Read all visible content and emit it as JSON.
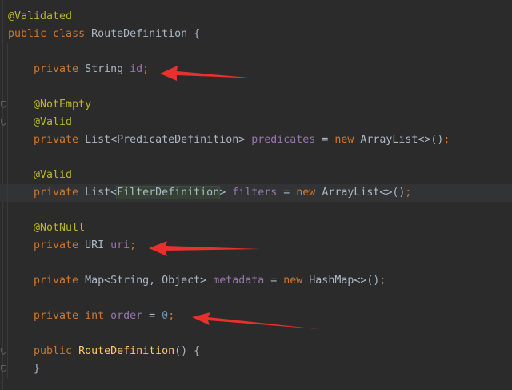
{
  "editor": {
    "lines": [
      {
        "id": "l01",
        "tokens": [
          {
            "t": "@Validated",
            "c": "ann"
          }
        ]
      },
      {
        "id": "l02",
        "tokens": [
          {
            "t": "public ",
            "c": "kw"
          },
          {
            "t": "class ",
            "c": "kw"
          },
          {
            "t": "RouteDefinition {",
            "c": "plain"
          }
        ]
      },
      {
        "id": "l03",
        "tokens": []
      },
      {
        "id": "l04",
        "tokens": [
          {
            "t": "    private ",
            "c": "kw"
          },
          {
            "t": "String ",
            "c": "plain"
          },
          {
            "t": "id",
            "c": "field"
          },
          {
            "t": ";",
            "c": "kw"
          }
        ]
      },
      {
        "id": "l05",
        "tokens": []
      },
      {
        "id": "l06",
        "tokens": [
          {
            "t": "    @NotEmpty",
            "c": "ann"
          }
        ]
      },
      {
        "id": "l07",
        "tokens": [
          {
            "t": "    @Valid",
            "c": "ann"
          }
        ]
      },
      {
        "id": "l08",
        "tokens": [
          {
            "t": "    private ",
            "c": "kw"
          },
          {
            "t": "List<PredicateDefinition> ",
            "c": "plain"
          },
          {
            "t": "predicates",
            "c": "field"
          },
          {
            "t": " = ",
            "c": "plain"
          },
          {
            "t": "new ",
            "c": "kw"
          },
          {
            "t": "ArrayList<>()",
            "c": "plain"
          },
          {
            "t": ";",
            "c": "kw"
          }
        ]
      },
      {
        "id": "l09",
        "tokens": []
      },
      {
        "id": "l10",
        "tokens": [
          {
            "t": "    @Valid",
            "c": "ann"
          }
        ]
      },
      {
        "id": "l11",
        "tokens": [
          {
            "t": "    private ",
            "c": "kw"
          },
          {
            "t": "List<",
            "c": "plain"
          },
          {
            "t": "FilterDefinition",
            "c": "plain",
            "hl": true
          },
          {
            "t": "> ",
            "c": "plain"
          },
          {
            "t": "filters",
            "c": "field"
          },
          {
            "t": " = ",
            "c": "plain"
          },
          {
            "t": "new ",
            "c": "kw"
          },
          {
            "t": "ArrayList<>()",
            "c": "plain"
          },
          {
            "t": ";",
            "c": "kw"
          }
        ]
      },
      {
        "id": "l12",
        "tokens": []
      },
      {
        "id": "l13",
        "tokens": [
          {
            "t": "    @NotNull",
            "c": "ann"
          }
        ]
      },
      {
        "id": "l14",
        "tokens": [
          {
            "t": "    private ",
            "c": "kw"
          },
          {
            "t": "URI ",
            "c": "plain"
          },
          {
            "t": "uri",
            "c": "field"
          },
          {
            "t": ";",
            "c": "kw"
          }
        ]
      },
      {
        "id": "l15",
        "tokens": []
      },
      {
        "id": "l16",
        "tokens": [
          {
            "t": "    private ",
            "c": "kw"
          },
          {
            "t": "Map<String, Object> ",
            "c": "plain"
          },
          {
            "t": "metadata",
            "c": "field"
          },
          {
            "t": " = ",
            "c": "plain"
          },
          {
            "t": "new ",
            "c": "kw"
          },
          {
            "t": "HashMap<>()",
            "c": "plain"
          },
          {
            "t": ";",
            "c": "kw"
          }
        ]
      },
      {
        "id": "l17",
        "tokens": []
      },
      {
        "id": "l18",
        "tokens": [
          {
            "t": "    private ",
            "c": "kw"
          },
          {
            "t": "int ",
            "c": "kw"
          },
          {
            "t": "order",
            "c": "field"
          },
          {
            "t": " = ",
            "c": "plain"
          },
          {
            "t": "0",
            "c": "num"
          },
          {
            "t": ";",
            "c": "kw"
          }
        ]
      },
      {
        "id": "l19",
        "tokens": []
      },
      {
        "id": "l20",
        "tokens": [
          {
            "t": "    public ",
            "c": "kw"
          },
          {
            "t": "RouteDefinition",
            "c": "fn"
          },
          {
            "t": "() {",
            "c": "plain"
          }
        ]
      },
      {
        "id": "l21",
        "tokens": [
          {
            "t": "    }",
            "c": "plain"
          }
        ]
      }
    ]
  },
  "annotations": {
    "arrow_color": "#e8302c",
    "arrow_count": 3
  },
  "colors": {
    "background": "#2b2b2b",
    "keyword": "#cc7832",
    "annotation": "#bbb529",
    "field": "#9876aa",
    "number": "#6897bb",
    "method": "#ffc66d",
    "text": "#a9b7c6"
  }
}
